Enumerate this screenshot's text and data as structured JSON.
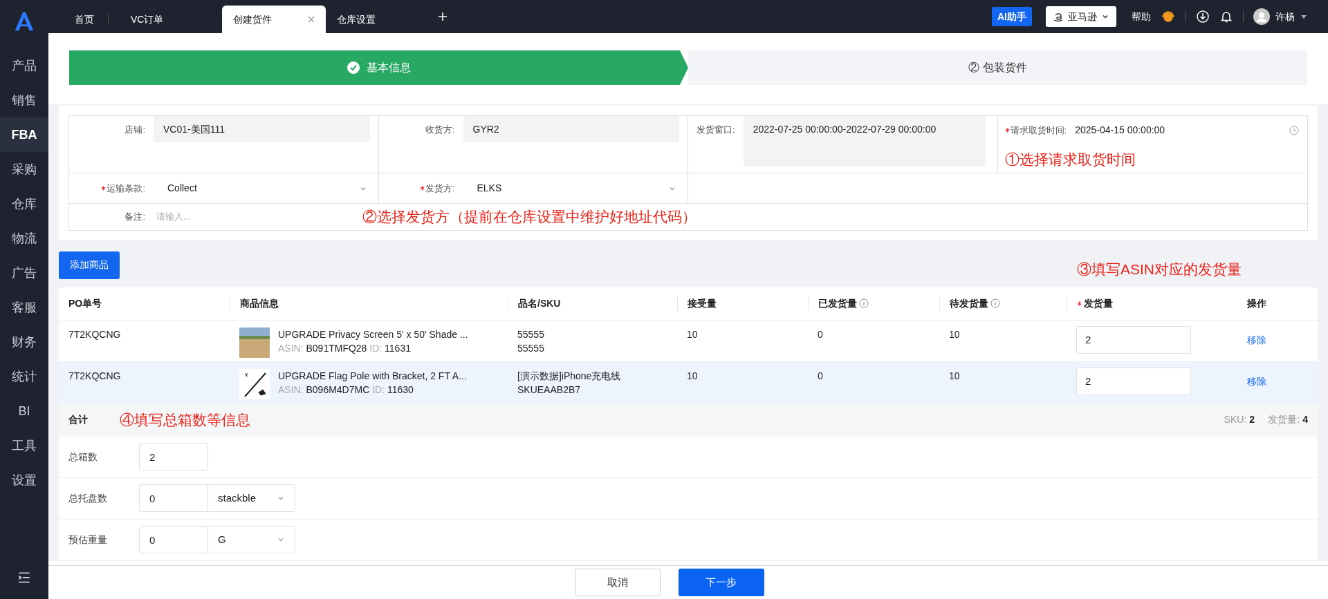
{
  "sidebar": [
    {
      "label": "产品",
      "selected": false
    },
    {
      "label": "销售",
      "selected": false
    },
    {
      "label": "FBA",
      "selected": true
    },
    {
      "label": "采购",
      "selected": false
    },
    {
      "label": "仓库",
      "selected": false
    },
    {
      "label": "物流",
      "selected": false
    },
    {
      "label": "广告",
      "selected": false
    },
    {
      "label": "客服",
      "selected": false
    },
    {
      "label": "财务",
      "selected": false
    },
    {
      "label": "统计",
      "selected": false
    },
    {
      "label": "BI",
      "selected": false
    },
    {
      "label": "工具",
      "selected": false
    },
    {
      "label": "设置",
      "selected": false
    }
  ],
  "tabs": [
    {
      "label": "首页",
      "selected": false
    },
    {
      "label": "VC订单",
      "selected": false
    },
    {
      "label": "创建货件",
      "selected": true
    },
    {
      "label": "仓库设置",
      "selected": false
    }
  ],
  "header": {
    "ai_button": "AI助手",
    "marketplace": "亚马逊",
    "help": "帮助",
    "user": "许杨"
  },
  "steps": [
    {
      "label": "基本信息",
      "done": true
    },
    {
      "label": "② 包装货件",
      "done": false
    }
  ],
  "form": {
    "row1": [
      {
        "label": "店铺:",
        "value": "VC01-美国111",
        "required": false,
        "kind": "readonly"
      },
      {
        "label": "收货方:",
        "value": "GYR2",
        "required": false,
        "kind": "readonly"
      },
      {
        "label": "发货窗口:",
        "value": "2022-07-25 00:00:00-2022-07-29 00:00:00",
        "required": false,
        "kind": "readonly"
      },
      {
        "label": "请求取货时间:",
        "value": "2025-04-15 00:00:00",
        "required": true,
        "kind": "datetime"
      }
    ],
    "row2": [
      {
        "label": "运输条款:",
        "value": "Collect",
        "required": true,
        "kind": "select"
      },
      {
        "label": "发货方:",
        "value": "ELKS",
        "required": true,
        "kind": "select"
      }
    ],
    "remark": {
      "label": "备注:",
      "placeholder": "请输入..."
    },
    "annotation_1": "①选择请求取货时间",
    "annotation_2": "②选择发货方（提前在仓库设置中维护好地址代码）"
  },
  "add_button": "添加商品",
  "annotation_3": "③填写ASIN对应的发货量",
  "table": {
    "columns": [
      {
        "label": "PO单号",
        "info": false,
        "required": false
      },
      {
        "label": "商品信息",
        "info": false,
        "required": false
      },
      {
        "label": "品名/SKU",
        "info": false,
        "required": false
      },
      {
        "label": "接受量",
        "info": false,
        "required": false
      },
      {
        "label": "已发货量",
        "info": true,
        "required": false
      },
      {
        "label": "待发货量",
        "info": true,
        "required": false
      },
      {
        "label": "发货量",
        "info": false,
        "required": true
      },
      {
        "label": "操作",
        "info": false,
        "required": false
      }
    ],
    "rows": [
      {
        "po": "7T2KQCNG",
        "title": "UPGRADE Privacy Screen 5' x 50' Shade ...",
        "asin_label": "ASIN:",
        "asin": "B091TMFQ28",
        "id_label": "ID:",
        "id": "11631",
        "name": "55555",
        "sku": "55555",
        "accepted": "10",
        "shipped": "0",
        "pending": "10",
        "quantity": "2",
        "action": "移除",
        "selected": false,
        "kind": "photo"
      },
      {
        "po": "7T2KQCNG",
        "title": "UPGRADE Flag Pole with Bracket, 2 FT A...",
        "asin_label": "ASIN:",
        "asin": "B096M4D7MC",
        "id_label": "ID:",
        "id": "11630",
        "name": "[演示数据]iPhone充电线",
        "sku": "SKUEAAB2B7",
        "accepted": "10",
        "shipped": "0",
        "pending": "10",
        "quantity": "2",
        "action": "移除",
        "selected": true,
        "kind": "drawing"
      }
    ],
    "total": {
      "label": "合计",
      "annotation": "④填写总箱数等信息",
      "sku_label": "SKU:",
      "sku": "2",
      "qty_label": "发货量:",
      "qty": "4"
    }
  },
  "totals": [
    {
      "label": "总箱数",
      "value": "2"
    },
    {
      "label": "总托盘数",
      "value": "0",
      "unit": "stackble"
    },
    {
      "label": "预估重量",
      "value": "0",
      "unit": "G"
    }
  ],
  "footer": {
    "cancel": "取消",
    "next": "下一步"
  }
}
